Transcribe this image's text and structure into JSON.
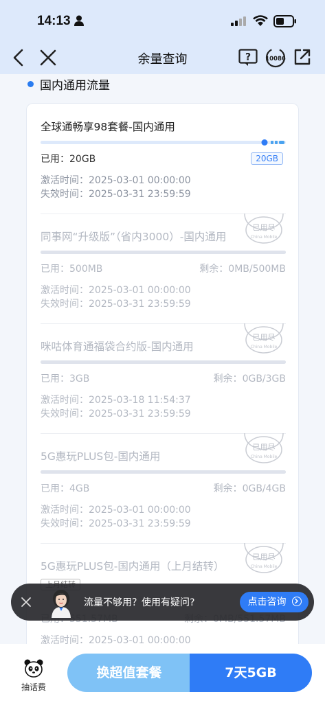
{
  "status_bar": {
    "time": "14:13"
  },
  "nav": {
    "title": "余量查询",
    "service_label": "10086"
  },
  "section": {
    "title": "国内通用流量"
  },
  "packages": [
    {
      "name": "全球通畅享98套餐-国内通用",
      "used_label": "已用：",
      "used": "20GB",
      "badge": "20GB",
      "activate_label": "激活时间：",
      "activate": "2025-03-01 00:00:00",
      "expire_label": "失效时间：",
      "expire": "2025-03-31 23:59:59",
      "used_fraction": 0.92
    },
    {
      "name": "同事网“升级版”（省内3000）-国内通用",
      "used_label": "已用：",
      "used": "500MB",
      "remain_label": "剩余：",
      "remain": "0MB/500MB",
      "activate_label": "激活时间：",
      "activate": "2025-03-01 00:00:00",
      "expire_label": "失效时间：",
      "expire": "2025-03-31 23:59:59",
      "stamp": "已用尽",
      "stamp_sub": "China Mobile",
      "used_fraction": 1
    },
    {
      "name": "咪咕体育通福袋合约版-国内通用",
      "used_label": "已用：",
      "used": "3GB",
      "remain_label": "剩余：",
      "remain": "0GB/3GB",
      "activate_label": "激活时间：",
      "activate": "2025-03-18 11:54:37",
      "expire_label": "失效时间：",
      "expire": "2025-03-31 23:59:59",
      "stamp": "已用尽",
      "stamp_sub": "China Mobile",
      "used_fraction": 1
    },
    {
      "name": "5G惠玩PLUS包-国内通用",
      "used_label": "已用：",
      "used": "4GB",
      "remain_label": "剩余：",
      "remain": "0GB/4GB",
      "activate_label": "激活时间：",
      "activate": "2025-03-01 00:00:00",
      "expire_label": "失效时间：",
      "expire": "2025-03-31 23:59:59",
      "stamp": "已用尽",
      "stamp_sub": "China Mobile",
      "used_fraction": 1
    },
    {
      "name": "5G惠玩PLUS包-国内通用（上月结转）",
      "tag": "上月结转",
      "used_label": "已用：",
      "used": "551.57MB",
      "remain_label": "剩余：",
      "remain": "0MB/551.57MB",
      "activate_label": "激活时间：",
      "activate": "2025-03-01 00:00:00",
      "stamp": "已用尽",
      "stamp_sub": "China Mobile",
      "used_fraction": 1
    }
  ],
  "toast": {
    "text": "流量不够用？使用有疑问?",
    "button": "点击咨询"
  },
  "bottom": {
    "panda_label": "抽话费",
    "left_button": "换超值套餐",
    "right_button": "7天5GB"
  },
  "colors": {
    "accent": "#2f7cf6",
    "light_accent": "#7fc2f6",
    "nav_bg": "#dde9fb"
  }
}
